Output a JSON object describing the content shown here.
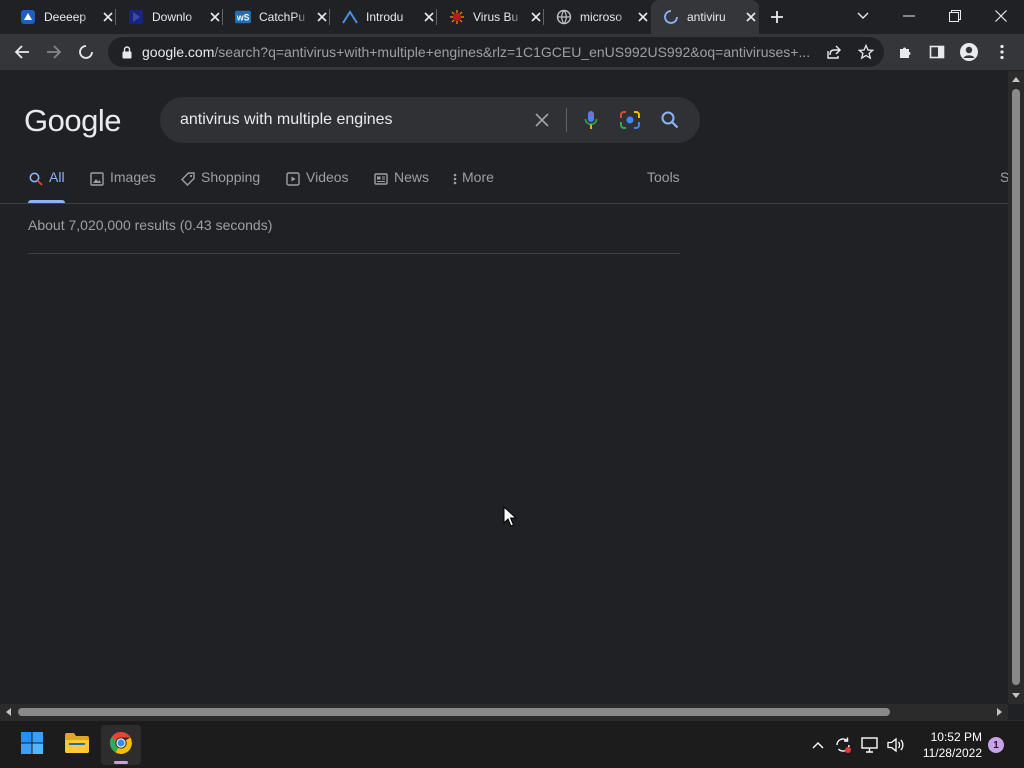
{
  "browser": {
    "tabs": [
      {
        "title": "Deeeep",
        "icon": "deeeep-favicon"
      },
      {
        "title": "Downlo",
        "icon": "download-favicon"
      },
      {
        "title": "CatchPu",
        "icon": "wordpress-favicon"
      },
      {
        "title": "Introdu",
        "icon": "triangle-favicon"
      },
      {
        "title": "Virus Bu",
        "icon": "virus-favicon"
      },
      {
        "title": "microso",
        "icon": "globe-favicon"
      },
      {
        "title": "antiviru",
        "icon": "loading-spinner"
      }
    ],
    "active_tab_index": 6,
    "address_bar": {
      "host": "google.com",
      "path": "/search?q=antivirus+with+multiple+engines&rlz=1C1GCEU_enUS992US992&oq=antiviruses+..."
    }
  },
  "page": {
    "logo_text": "Google",
    "search": {
      "query": "antivirus with multiple engines"
    },
    "nav_tabs": [
      {
        "label": "All",
        "icon": "search-icon",
        "active": true
      },
      {
        "label": "Images",
        "icon": "image-icon"
      },
      {
        "label": "Shopping",
        "icon": "tag-icon"
      },
      {
        "label": "Videos",
        "icon": "video-icon"
      },
      {
        "label": "News",
        "icon": "news-icon"
      },
      {
        "label": "More",
        "icon": "more-vert-icon"
      }
    ],
    "tools_label": "Tools",
    "edge_cutoff_label": "S",
    "result_stats": "About 7,020,000 results (0.43 seconds)"
  },
  "taskbar": {
    "apps": [
      {
        "name": "start",
        "icon": "windows-logo-icon"
      },
      {
        "name": "file-explorer",
        "icon": "folder-icon"
      },
      {
        "name": "chrome",
        "icon": "chrome-icon",
        "active": true
      }
    ],
    "clock": {
      "time": "10:52 PM",
      "date": "11/28/2022"
    },
    "notification_count": "1"
  },
  "colors": {
    "page_bg": "#202124",
    "toolbar_bg": "#35363a",
    "accent_blue": "#8ab4f8",
    "muted_text": "#9aa0a6"
  }
}
